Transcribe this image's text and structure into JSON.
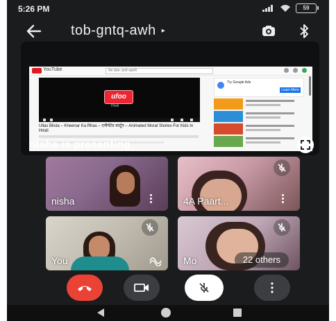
{
  "status_bar": {
    "time": "5:26 PM",
    "battery": "59"
  },
  "header": {
    "meeting_code": "tob-gntq-awh",
    "caret": "▸",
    "icons": [
      "back-arrow-icon",
      "camera-switch-icon",
      "bluetooth-icon"
    ]
  },
  "presentation": {
    "label": "nisha is presenting",
    "screen": {
      "site": "YouTube",
      "search_placeholder": "मेरा दोस्त: हाथी कहानी",
      "player_logo": "ufoo",
      "player_subtitle": "Hindi",
      "video_title": "Ullas Blista – Kheenar Ka Rhas – एनीमेटेड कार्टून – Animated Moral Stories For Kids In Hindi",
      "ad_title": "Try Google Ads",
      "ad_button": "Learn More"
    }
  },
  "participants": [
    {
      "name": "nisha",
      "muted": false,
      "has_menu": true
    },
    {
      "name": "4A Paart...",
      "muted": true,
      "has_menu": true
    },
    {
      "name": "You",
      "muted": true,
      "has_menu": false
    },
    {
      "name": "Mo",
      "muted": true,
      "has_menu": false
    }
  ],
  "others_label": "22 others",
  "controls": [
    "end-call",
    "camera",
    "microphone-muted",
    "more-options"
  ],
  "colors": {
    "background": "#1b1c1e",
    "end_call": "#ea4335",
    "control_dark": "#3c3d40",
    "control_light": "#ffffff"
  }
}
